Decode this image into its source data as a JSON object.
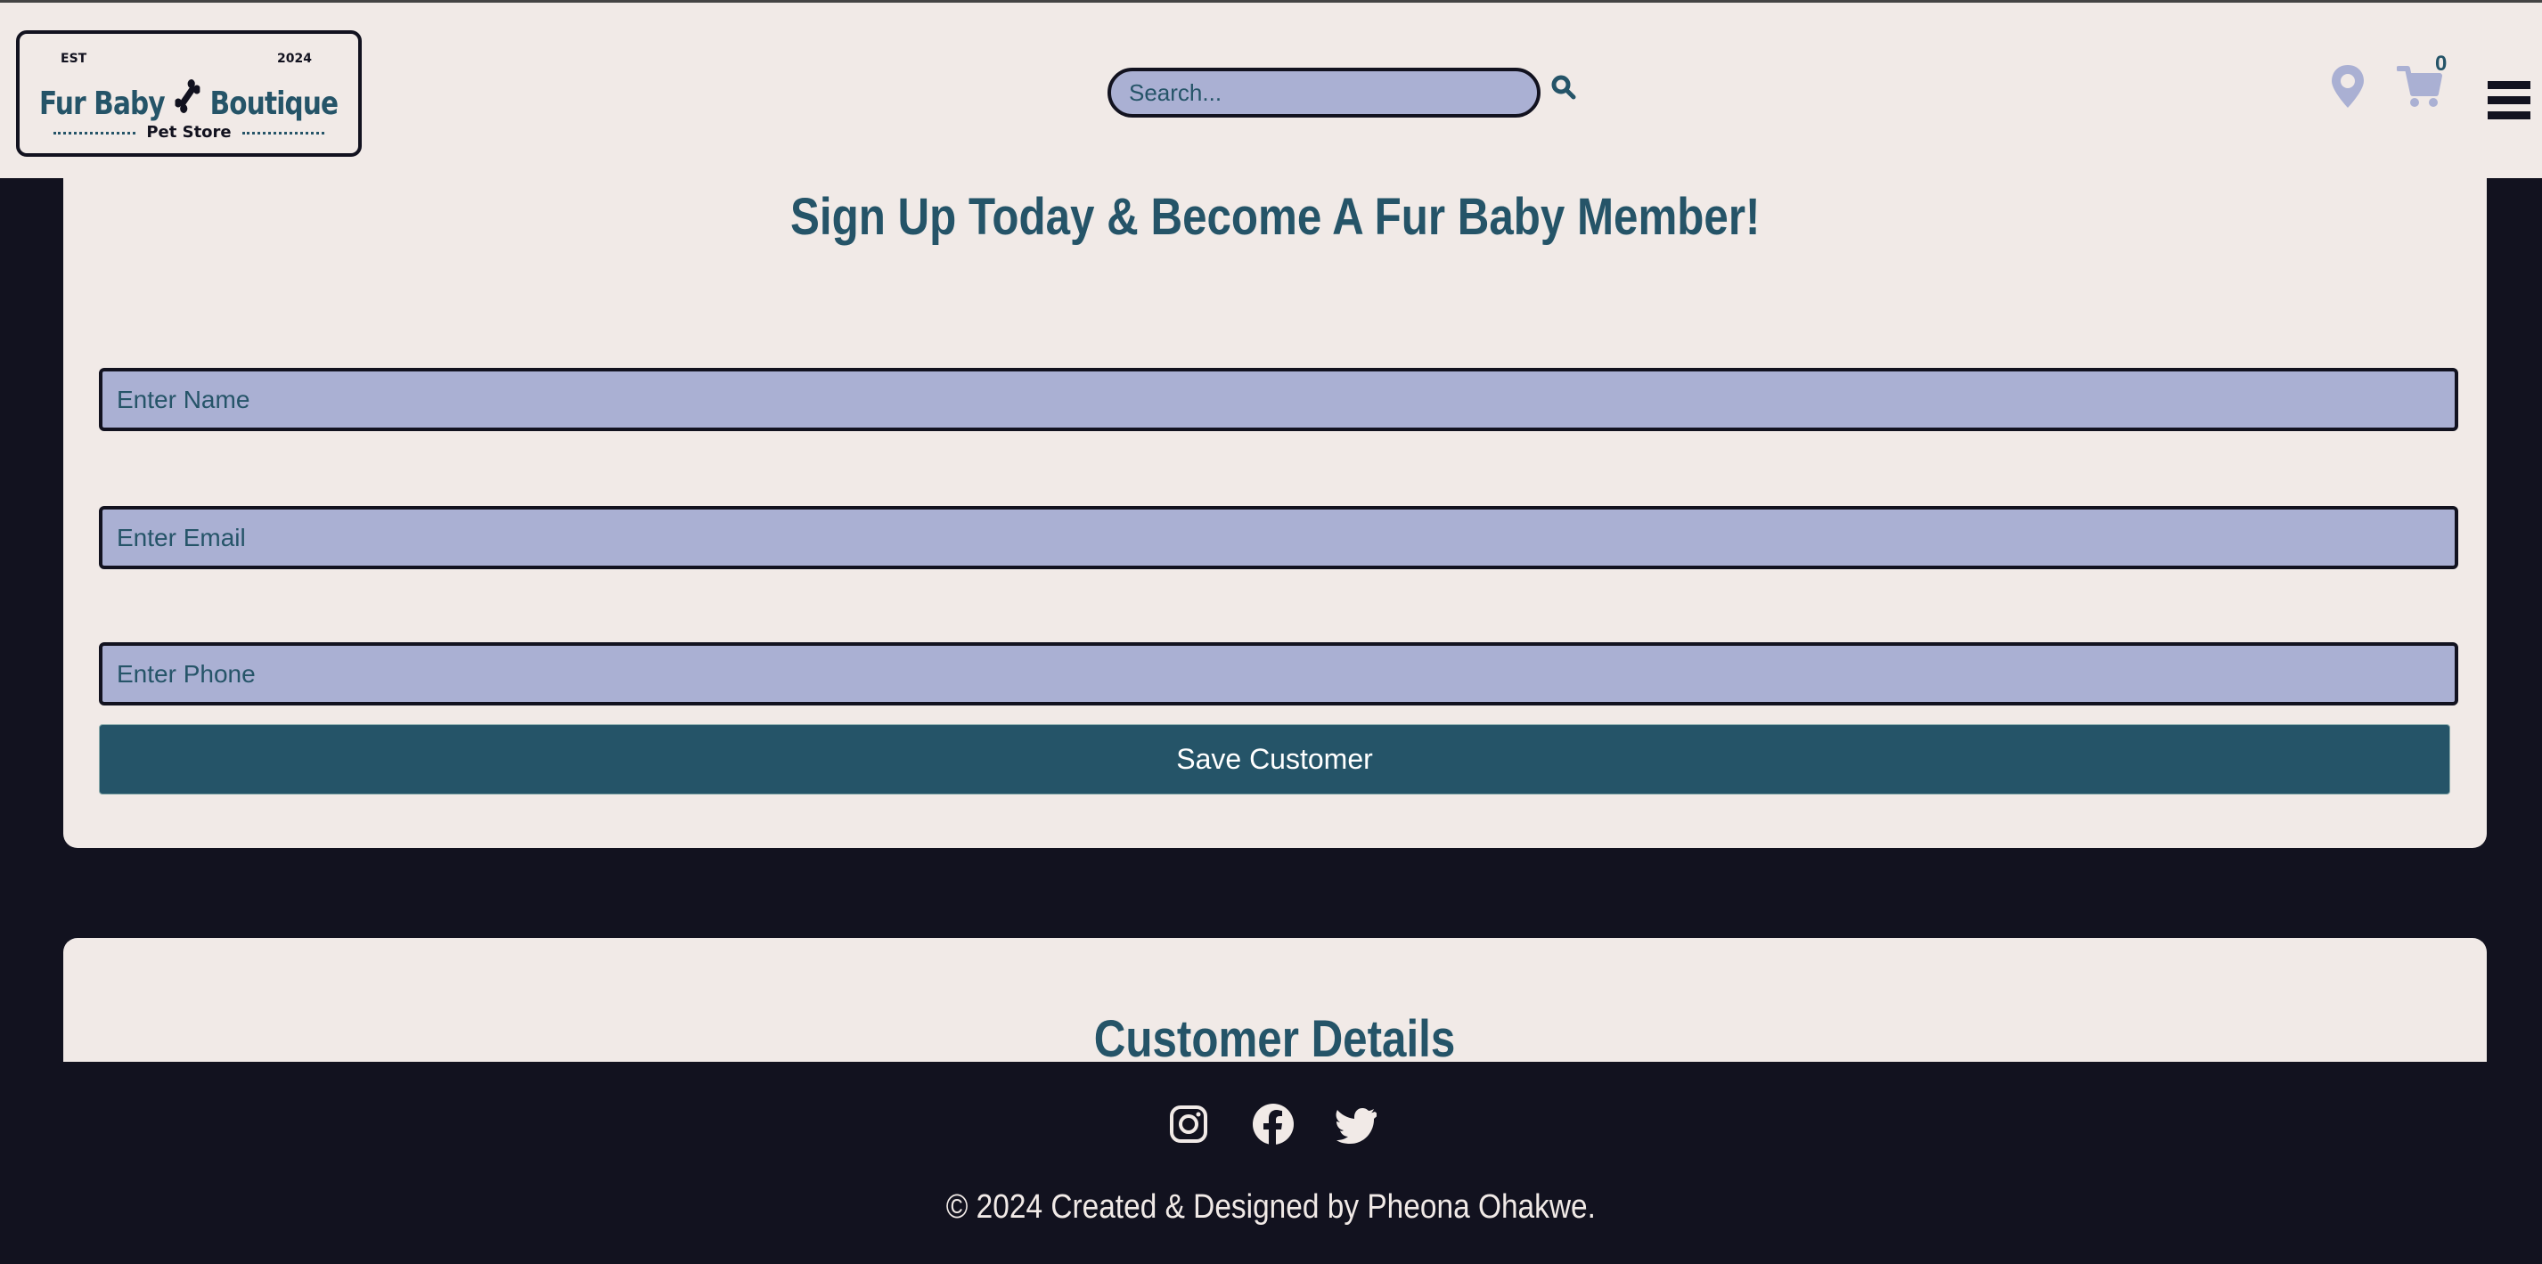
{
  "header": {
    "logo": {
      "est": "EST",
      "year": "2024",
      "name_left": "Fur Baby",
      "name_right": "Boutique",
      "subtitle": "Pet Store"
    },
    "search": {
      "placeholder": "Search..."
    },
    "cart_count": "0"
  },
  "signup": {
    "title": "Sign Up Today & Become A Fur Baby Member!",
    "name_placeholder": "Enter Name",
    "email_placeholder": "Enter Email",
    "phone_placeholder": "Enter Phone",
    "save_label": "Save Customer"
  },
  "details": {
    "title": "Customer Details"
  },
  "footer": {
    "copyright": "© 2024 Created & Designed by Pheona Ohakwe.",
    "social": [
      "instagram-icon",
      "facebook-icon",
      "twitter-icon"
    ]
  },
  "colors": {
    "primary": "#255468",
    "background": "#12121f",
    "surface": "#f1eae7",
    "input": "#aab0d3"
  }
}
